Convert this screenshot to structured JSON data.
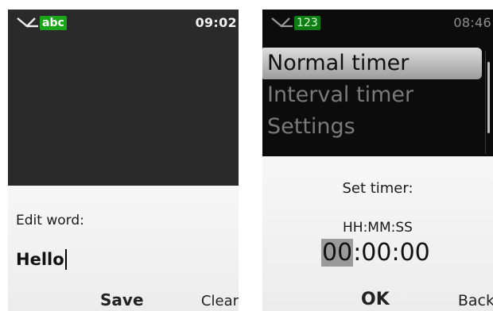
{
  "left": {
    "status": {
      "mode": "abc",
      "time": "09:02",
      "network_icon": "network-signal-icon"
    },
    "dialog": {
      "label": "Edit word:",
      "value": "Hello"
    },
    "softkeys": {
      "center": "Save",
      "right": "Clear"
    }
  },
  "right": {
    "status": {
      "mode": "123",
      "time": "08:46",
      "network_icon": "network-signal-icon"
    },
    "menu": {
      "items": [
        {
          "label": "Normal timer",
          "selected": true
        },
        {
          "label": "Interval timer",
          "selected": false
        },
        {
          "label": "Settings",
          "selected": false
        }
      ]
    },
    "dialog": {
      "title": "Set timer:",
      "format": "HH:MM:SS",
      "time_active_segment": "00",
      "time_rest": ":00:00"
    },
    "softkeys": {
      "center": "OK",
      "right": "Back"
    }
  },
  "colors": {
    "mode_badge": "#1aa51a",
    "dialog_bg": "#f2f2f2",
    "screen_bg": "#2a2a2a"
  }
}
